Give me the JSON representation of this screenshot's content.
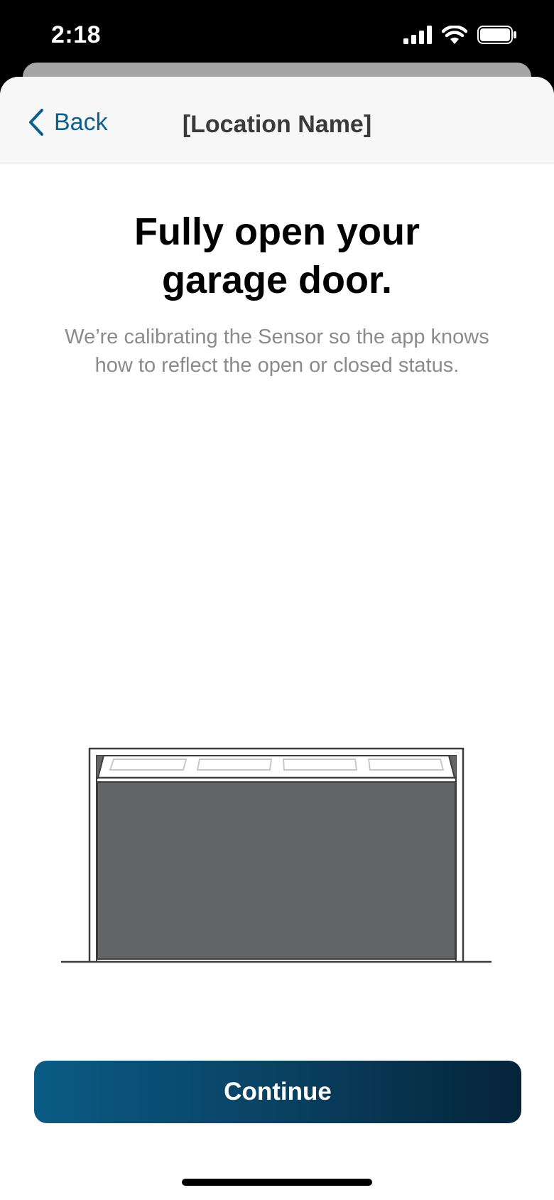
{
  "status_bar": {
    "time": "2:18",
    "icons": [
      "cellular-signal-icon",
      "wifi-icon",
      "battery-icon"
    ]
  },
  "nav": {
    "back_label": "Back",
    "title": "[Location Name]"
  },
  "content": {
    "headline": "Fully open your\ngarage door.",
    "subtitle": "We’re calibrating the Sensor so the app knows\nhow to reflect the open or closed status."
  },
  "illustration": {
    "icon": "garage-door-illustration",
    "door_color": "#646567"
  },
  "actions": {
    "continue_label": "Continue"
  },
  "colors": {
    "accent": "#0d5f8c",
    "button_gradient_start": "#0a5b86",
    "button_gradient_end": "#05243a"
  }
}
